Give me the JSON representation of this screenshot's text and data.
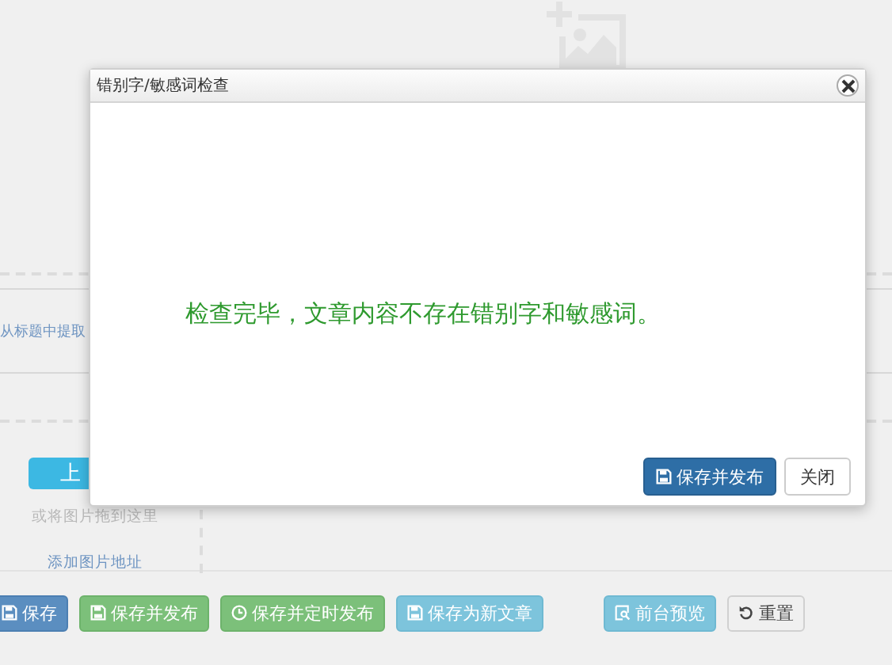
{
  "background": {
    "extract_link": "从标题中提取",
    "upload_button": "上",
    "drag_hint": "或将图片拖到这里",
    "add_url_link": "添加图片地址"
  },
  "toolbar": [
    {
      "label": "保存",
      "kind": "save"
    },
    {
      "label": "保存并发布",
      "kind": "publish"
    },
    {
      "label": "保存并定时发布",
      "kind": "schedule"
    },
    {
      "label": "保存为新文章",
      "kind": "copy"
    },
    {
      "label": "前台预览",
      "kind": "preview"
    },
    {
      "label": "重置",
      "kind": "reset"
    }
  ],
  "dialog": {
    "title": "错别字/敏感词检查",
    "message": "检查完毕，文章内容不存在错别字和敏感词。",
    "buttons": [
      {
        "label": "保存并发布",
        "kind": "publish"
      },
      {
        "label": "关闭",
        "kind": "close"
      }
    ]
  }
}
